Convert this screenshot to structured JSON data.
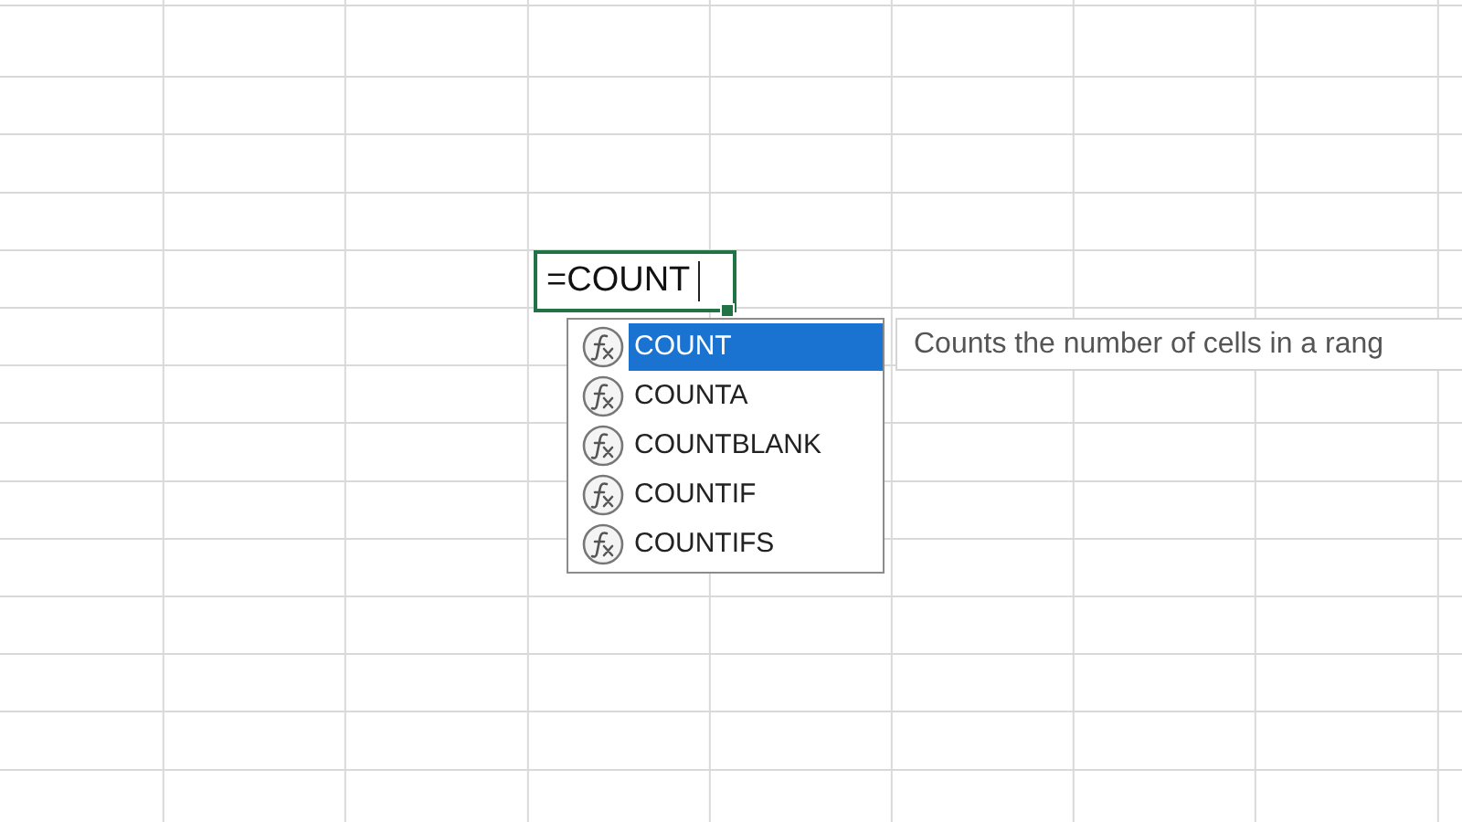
{
  "cell": {
    "value": "=COUNT"
  },
  "autocomplete": {
    "items": [
      {
        "name": "COUNT",
        "selected": true
      },
      {
        "name": "COUNTA",
        "selected": false
      },
      {
        "name": "COUNTBLANK",
        "selected": false
      },
      {
        "name": "COUNTIF",
        "selected": false
      },
      {
        "name": "COUNTIFS",
        "selected": false
      }
    ]
  },
  "tooltip": {
    "text": "Counts the number of cells in a rang"
  }
}
